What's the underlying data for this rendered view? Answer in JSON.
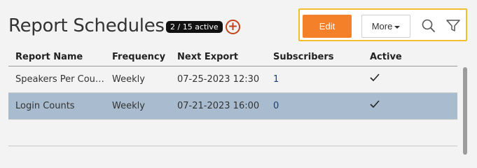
{
  "header": {
    "title": "Report Schedules",
    "badge": "2 / 15 active",
    "add_icon": "plus-circle-icon",
    "accent_color": "#c2431d"
  },
  "toolbar": {
    "edit_label": "Edit",
    "more_label": "More",
    "search_icon": "search-icon",
    "filter_icon": "filter-icon",
    "highlight_color": "#f2be2f",
    "primary_color": "#f5802a"
  },
  "table": {
    "columns": [
      "Report Name",
      "Frequency",
      "Next Export",
      "Subscribers",
      "Active"
    ],
    "rows": [
      {
        "name": "Speakers Per Cou…",
        "frequency": "Weekly",
        "next_export": "07-25-2023 12:30",
        "subscribers": "1",
        "active": true,
        "selected": false
      },
      {
        "name": "Login Counts",
        "frequency": "Weekly",
        "next_export": "07-21-2023 16:00",
        "subscribers": "0",
        "active": true,
        "selected": true
      }
    ],
    "selected_row_color": "#a9bccf"
  }
}
